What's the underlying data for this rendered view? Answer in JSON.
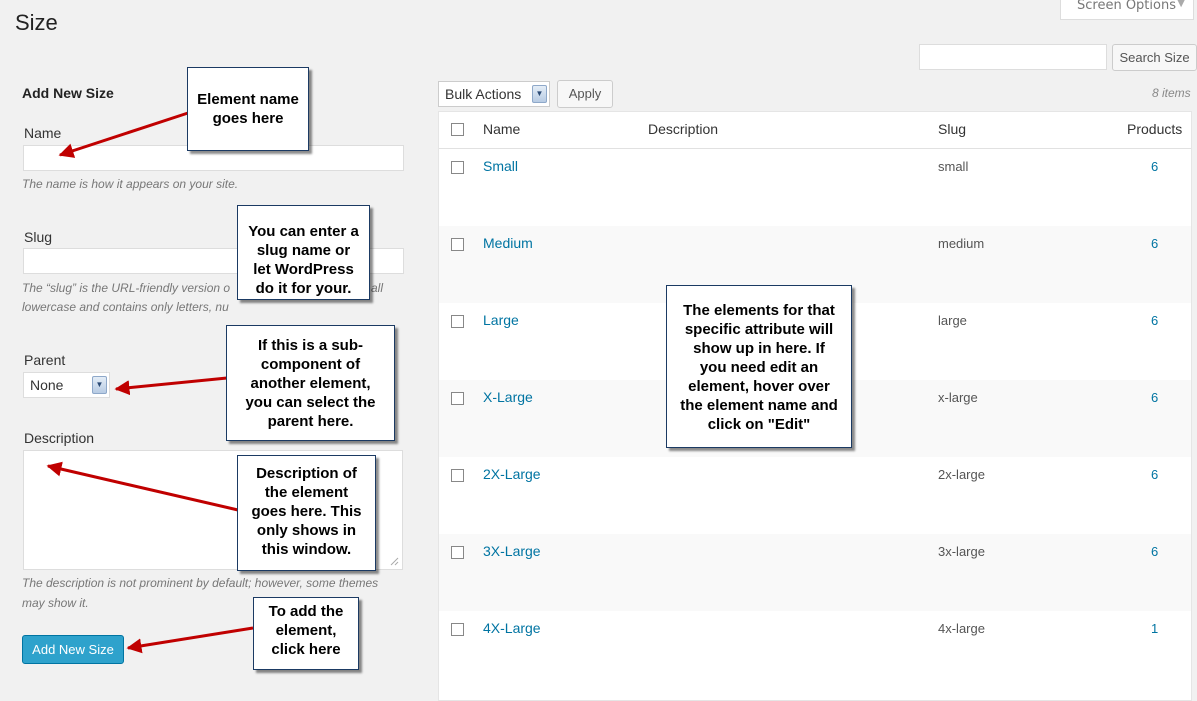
{
  "page": {
    "title": "Size",
    "screen_options": "Screen Options"
  },
  "search": {
    "button": "Search Size"
  },
  "form": {
    "title": "Add New Size",
    "name_label": "Name",
    "name_help": "The name is how it appears on your site.",
    "slug_label": "Slug",
    "slug_help_1": "The “slug” is the URL-friendly version o",
    "slug_help_1b": "all",
    "slug_help_2": "lowercase and contains only letters, nu",
    "parent_label": "Parent",
    "parent_value": "None",
    "description_label": "Description",
    "description_help_1": "The description is not prominent by default; however, some themes",
    "description_help_2": "may show it.",
    "submit": "Add New Size"
  },
  "toolbar": {
    "bulk_actions": "Bulk Actions",
    "apply": "Apply",
    "items_count": "8 items"
  },
  "table": {
    "headers": {
      "name": "Name",
      "description": "Description",
      "slug": "Slug",
      "products": "Products"
    },
    "rows": [
      {
        "name": "Small",
        "slug": "small",
        "count": "6"
      },
      {
        "name": "Medium",
        "slug": "medium",
        "count": "6"
      },
      {
        "name": "Large",
        "slug": "large",
        "count": "6"
      },
      {
        "name": "X-Large",
        "slug": "x-large",
        "count": "6"
      },
      {
        "name": "2X-Large",
        "slug": "2x-large",
        "count": "6"
      },
      {
        "name": "3X-Large",
        "slug": "3x-large",
        "count": "6"
      },
      {
        "name": "4X-Large",
        "slug": "4x-large",
        "count": "1"
      }
    ]
  },
  "callouts": {
    "element_name": [
      "Element name",
      "goes here"
    ],
    "slug": [
      "You can enter a",
      "slug name or",
      "let WordPress",
      "do it for your."
    ],
    "parent": [
      "If this is a sub-",
      "component of",
      "another element,",
      "you can select the",
      "parent here."
    ],
    "description": [
      "Description of",
      "the element",
      "goes here.  This",
      "only shows in",
      "this window."
    ],
    "add": [
      "To add the",
      "element,",
      "click here"
    ],
    "table": [
      "The elements for that",
      "specific attribute will",
      "show up in here.  If",
      "you need edit an",
      "element, hover over",
      "the element name and",
      "click on \"Edit\""
    ]
  },
  "colors": {
    "primary": "#2ea2cc",
    "link": "#0074a2",
    "arrow": "#c00000"
  }
}
